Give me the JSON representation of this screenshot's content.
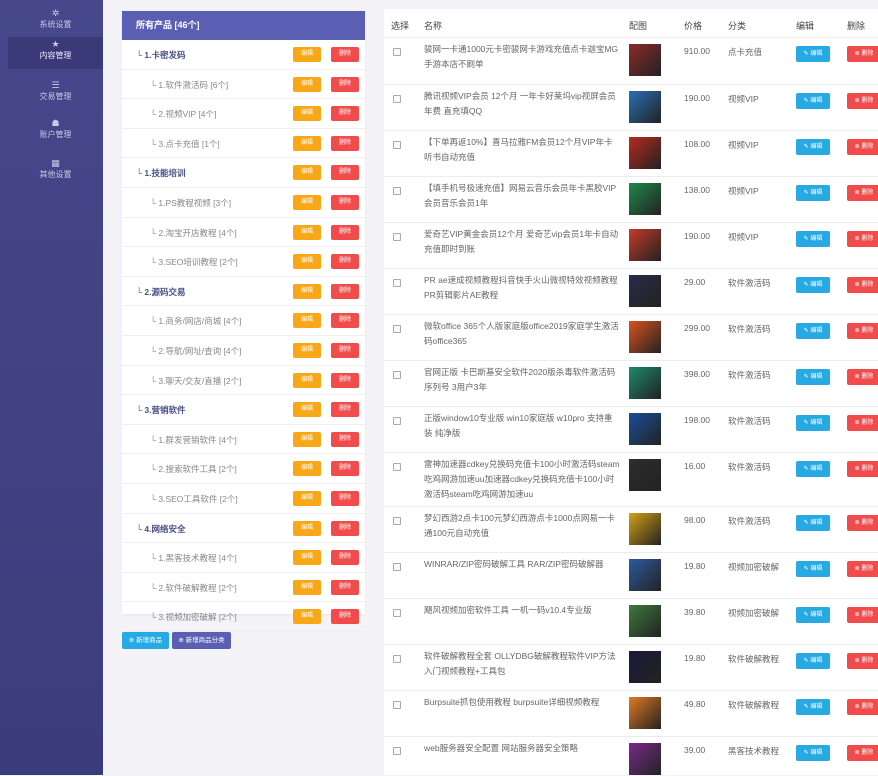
{
  "sidebar": {
    "items": [
      {
        "label": "系统设置",
        "icon": "gear-icon"
      },
      {
        "label": "内容管理",
        "icon": "star-icon"
      },
      {
        "label": "交易管理",
        "icon": "list-icon"
      },
      {
        "label": "账户管理",
        "icon": "users-icon"
      },
      {
        "label": "其他设置",
        "icon": "grid-icon"
      }
    ]
  },
  "categories": {
    "header": "所有产品 [46个]",
    "edit_label": "编辑",
    "delete_label": "删除",
    "rows": [
      {
        "level": "top",
        "name": "└ 1.卡密发码"
      },
      {
        "level": "sub",
        "name": "└ 1.软件激活码 [6个]"
      },
      {
        "level": "sub",
        "name": "└ 2.视频VIP [4个]"
      },
      {
        "level": "sub",
        "name": "└ 3.点卡充值 [1个]"
      },
      {
        "level": "top",
        "name": "└ 1.技能培训"
      },
      {
        "level": "sub",
        "name": "└ 1.PS教程视频 [3个]"
      },
      {
        "level": "sub",
        "name": "└ 2.淘宝开店教程 [4个]"
      },
      {
        "level": "sub",
        "name": "└ 3.SEO培训教程 [2个]"
      },
      {
        "level": "top",
        "name": "└ 2.源码交易"
      },
      {
        "level": "sub",
        "name": "└ 1.商务/网店/商城 [4个]"
      },
      {
        "level": "sub",
        "name": "└ 2.导航/网址/查询 [4个]"
      },
      {
        "level": "sub",
        "name": "└ 3.聊天/交友/直播 [2个]"
      },
      {
        "level": "top",
        "name": "└ 3.营销软件"
      },
      {
        "level": "sub",
        "name": "└ 1.群发营销软件 [4个]"
      },
      {
        "level": "sub",
        "name": "└ 2.搜索软件工具 [2个]"
      },
      {
        "level": "sub",
        "name": "└ 3.SEO工具软件 [2个]"
      },
      {
        "level": "top",
        "name": "└ 4.网络安全"
      },
      {
        "level": "sub",
        "name": "└ 1.黑客技术教程 [4个]"
      },
      {
        "level": "sub",
        "name": "└ 2.软件破解教程 [2个]"
      },
      {
        "level": "sub",
        "name": "└ 3.视频加密破解 [2个]"
      }
    ],
    "add_product_label": "新增商品",
    "add_category_label": "新增商品分类"
  },
  "table": {
    "headers": {
      "select": "选择",
      "name": "名称",
      "image": "配图",
      "price": "价格",
      "category": "分类",
      "edit": "编辑",
      "delete": "删除"
    },
    "edit_label": "编辑",
    "delete_label": "删除",
    "rows": [
      {
        "name": "骏网一卡通1000元卡密骏网卡游戏充值点卡迦宝MG手游本店不刷单",
        "price": "910.00",
        "category": "点卡充值",
        "thumb": "#8a2b2b"
      },
      {
        "name": "腾讯视频VIP会员 12个月 一年卡好莱坞vip视屏会员年费 直充填QQ",
        "price": "190.00",
        "category": "视频VIP",
        "thumb": "#2b6fb5"
      },
      {
        "name": "【下单再返10%】喜马拉雅FM会员12个月VIP年卡听书自动充值",
        "price": "108.00",
        "category": "视频VIP",
        "thumb": "#b52b1f"
      },
      {
        "name": "【填手机号极速充值】网易云音乐会员年卡黑胶VIP会员音乐会员1年",
        "price": "138.00",
        "category": "视频VIP",
        "thumb": "#1e8a4a"
      },
      {
        "name": "爱奇艺VIP黄金会员12个月 爱奇艺vip会员1年卡自动充值即时到账",
        "price": "190.00",
        "category": "视频VIP",
        "thumb": "#c53a2a"
      },
      {
        "name": "PR ae速成视频教程抖音快手火山微视特效视频教程PR剪辑影片AE教程",
        "price": "29.00",
        "category": "软件激活码",
        "thumb": "#2a2a4a"
      },
      {
        "name": "微软office 365个人版家庭版office2019家庭学生激活码office365",
        "price": "299.00",
        "category": "软件激活码",
        "thumb": "#d9531e"
      },
      {
        "name": "官网正版 卡巴斯基安全软件2020版杀毒软件激活码序列号 3用户3年",
        "price": "398.00",
        "category": "软件激活码",
        "thumb": "#1d8a6a"
      },
      {
        "name": "正版window10专业版 win10家庭版 w10pro 支持重装 纯净版",
        "price": "198.00",
        "category": "软件激活码",
        "thumb": "#1a4f9a"
      },
      {
        "name": "雷神加速器cdkey兑换码充值卡100小时激活码steam吃鸡网游加速uu加速器cdkey兑换码充值卡100小时激活码steam吃鸡网游加速uu",
        "price": "16.00",
        "category": "软件激活码",
        "thumb": "#2d2d2d"
      },
      {
        "name": "梦幻西游2点卡100元梦幻西游点卡1000点网易一卡通100元自动充值",
        "price": "98.00",
        "category": "软件激活码",
        "thumb": "#d4a017"
      },
      {
        "name": "WINRAR/ZIP密码破解工具 RAR/ZIP密码破解器",
        "price": "19.80",
        "category": "视频加密破解",
        "thumb": "#2d5aa0"
      },
      {
        "name": "飓风视频加密软件工具 一机一码v10.4专业版",
        "price": "39.80",
        "category": "视频加密破解",
        "thumb": "#3c7a3c"
      },
      {
        "name": "软件破解教程全套 OLLYDBG破解教程软件VIP方法入门视频教程+工具包",
        "price": "19.80",
        "category": "软件破解教程",
        "thumb": "#1a1a3a"
      },
      {
        "name": "Burpsuite抓包使用教程 burpsuite详细视频教程",
        "price": "49.80",
        "category": "软件破解教程",
        "thumb": "#e07a1f"
      },
      {
        "name": "web服务器安全配置 网站服务器安全策略",
        "price": "39.00",
        "category": "黑客技术教程",
        "thumb": "#7a2a8a"
      }
    ]
  }
}
